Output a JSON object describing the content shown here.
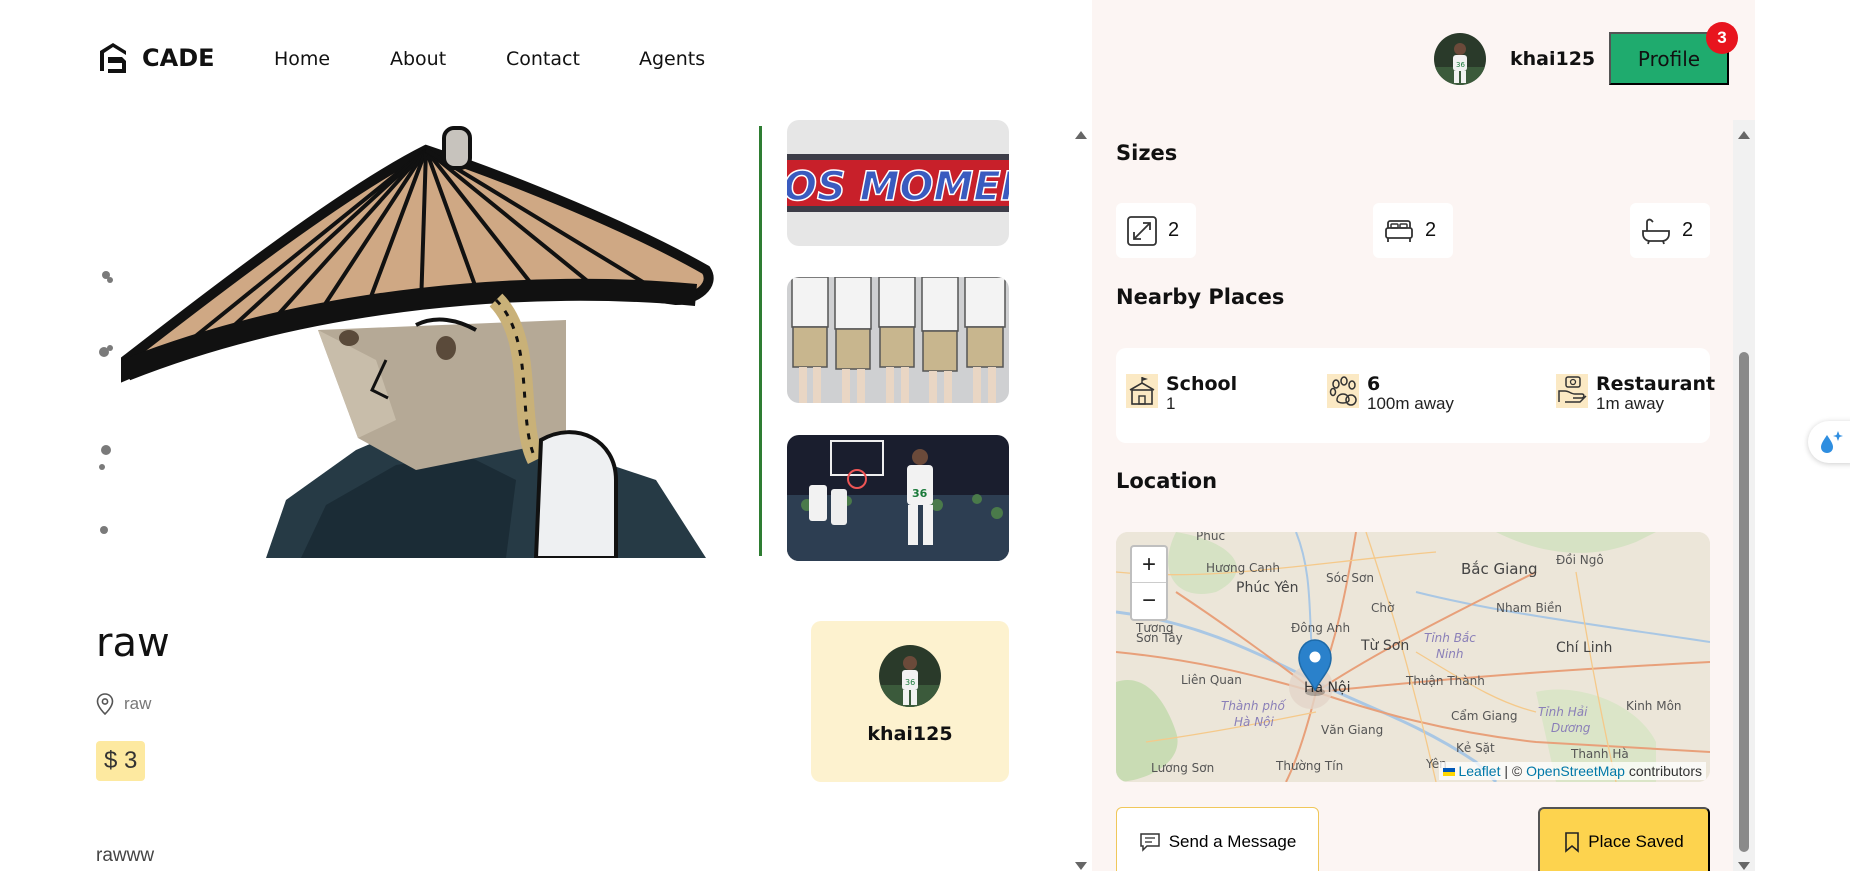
{
  "brand": {
    "name": "CADE"
  },
  "nav": {
    "items": [
      "Home",
      "About",
      "Contact",
      "Agents"
    ]
  },
  "user": {
    "name": "khai125",
    "profile_label": "Profile",
    "notification_count": "3"
  },
  "listing": {
    "title": "raw",
    "address": "raw",
    "price": "$ 3",
    "description": "rawww",
    "thumb_text": "OS MOMEN"
  },
  "owner": {
    "name": "khai125"
  },
  "sizes": {
    "title": "Sizes",
    "items": [
      {
        "icon": "area-icon",
        "value": "2"
      },
      {
        "icon": "bed-icon",
        "value": "2"
      },
      {
        "icon": "bathtub-icon",
        "value": "2"
      }
    ]
  },
  "nearby": {
    "title": "Nearby Places",
    "items": [
      {
        "icon": "school-icon",
        "title": "School",
        "sub": "1"
      },
      {
        "icon": "pet-icon",
        "title": "6",
        "sub": "100m away"
      },
      {
        "icon": "restaurant-icon",
        "title": "Restaurant",
        "sub": "1m away"
      }
    ]
  },
  "location": {
    "title": "Location",
    "zoom_in": "+",
    "zoom_out": "−",
    "attribution": {
      "leaflet": "Leaflet",
      "sep": "| ©",
      "osm": "OpenStreetMap",
      "suffix": "contributors"
    },
    "map_labels": [
      "Phúc",
      "Hương Canh",
      "Phúc Yên",
      "Sóc Sơn",
      "Bắc Giang",
      "Đồi Ngô",
      "Tương",
      "Đông Anh",
      "Chờ",
      "Nham Biền",
      "Sơn Tây",
      "Từ Sơn",
      "Tỉnh Bắc",
      "Ninh",
      "Chí Linh",
      "Liên Quan",
      "Hà Nội",
      "Thuận Thành",
      "Thành phố",
      "Hà Nội",
      "Văn Giang",
      "Cẩm Giang",
      "Tỉnh Hải",
      "Dương",
      "Kinh Môn",
      "Kẻ Sặt",
      "Thanh Hà",
      "Lương Sơn",
      "Thường Tín",
      "Yên"
    ]
  },
  "actions": {
    "message_label": "Send a Message",
    "save_label": "Place Saved"
  },
  "colors": {
    "accent_green": "#1fab6e",
    "badge_red": "#e8141e",
    "panel_pink": "#fcf5f3",
    "saved_yellow": "#fdd34e",
    "owner_card": "#fdf2cf"
  }
}
